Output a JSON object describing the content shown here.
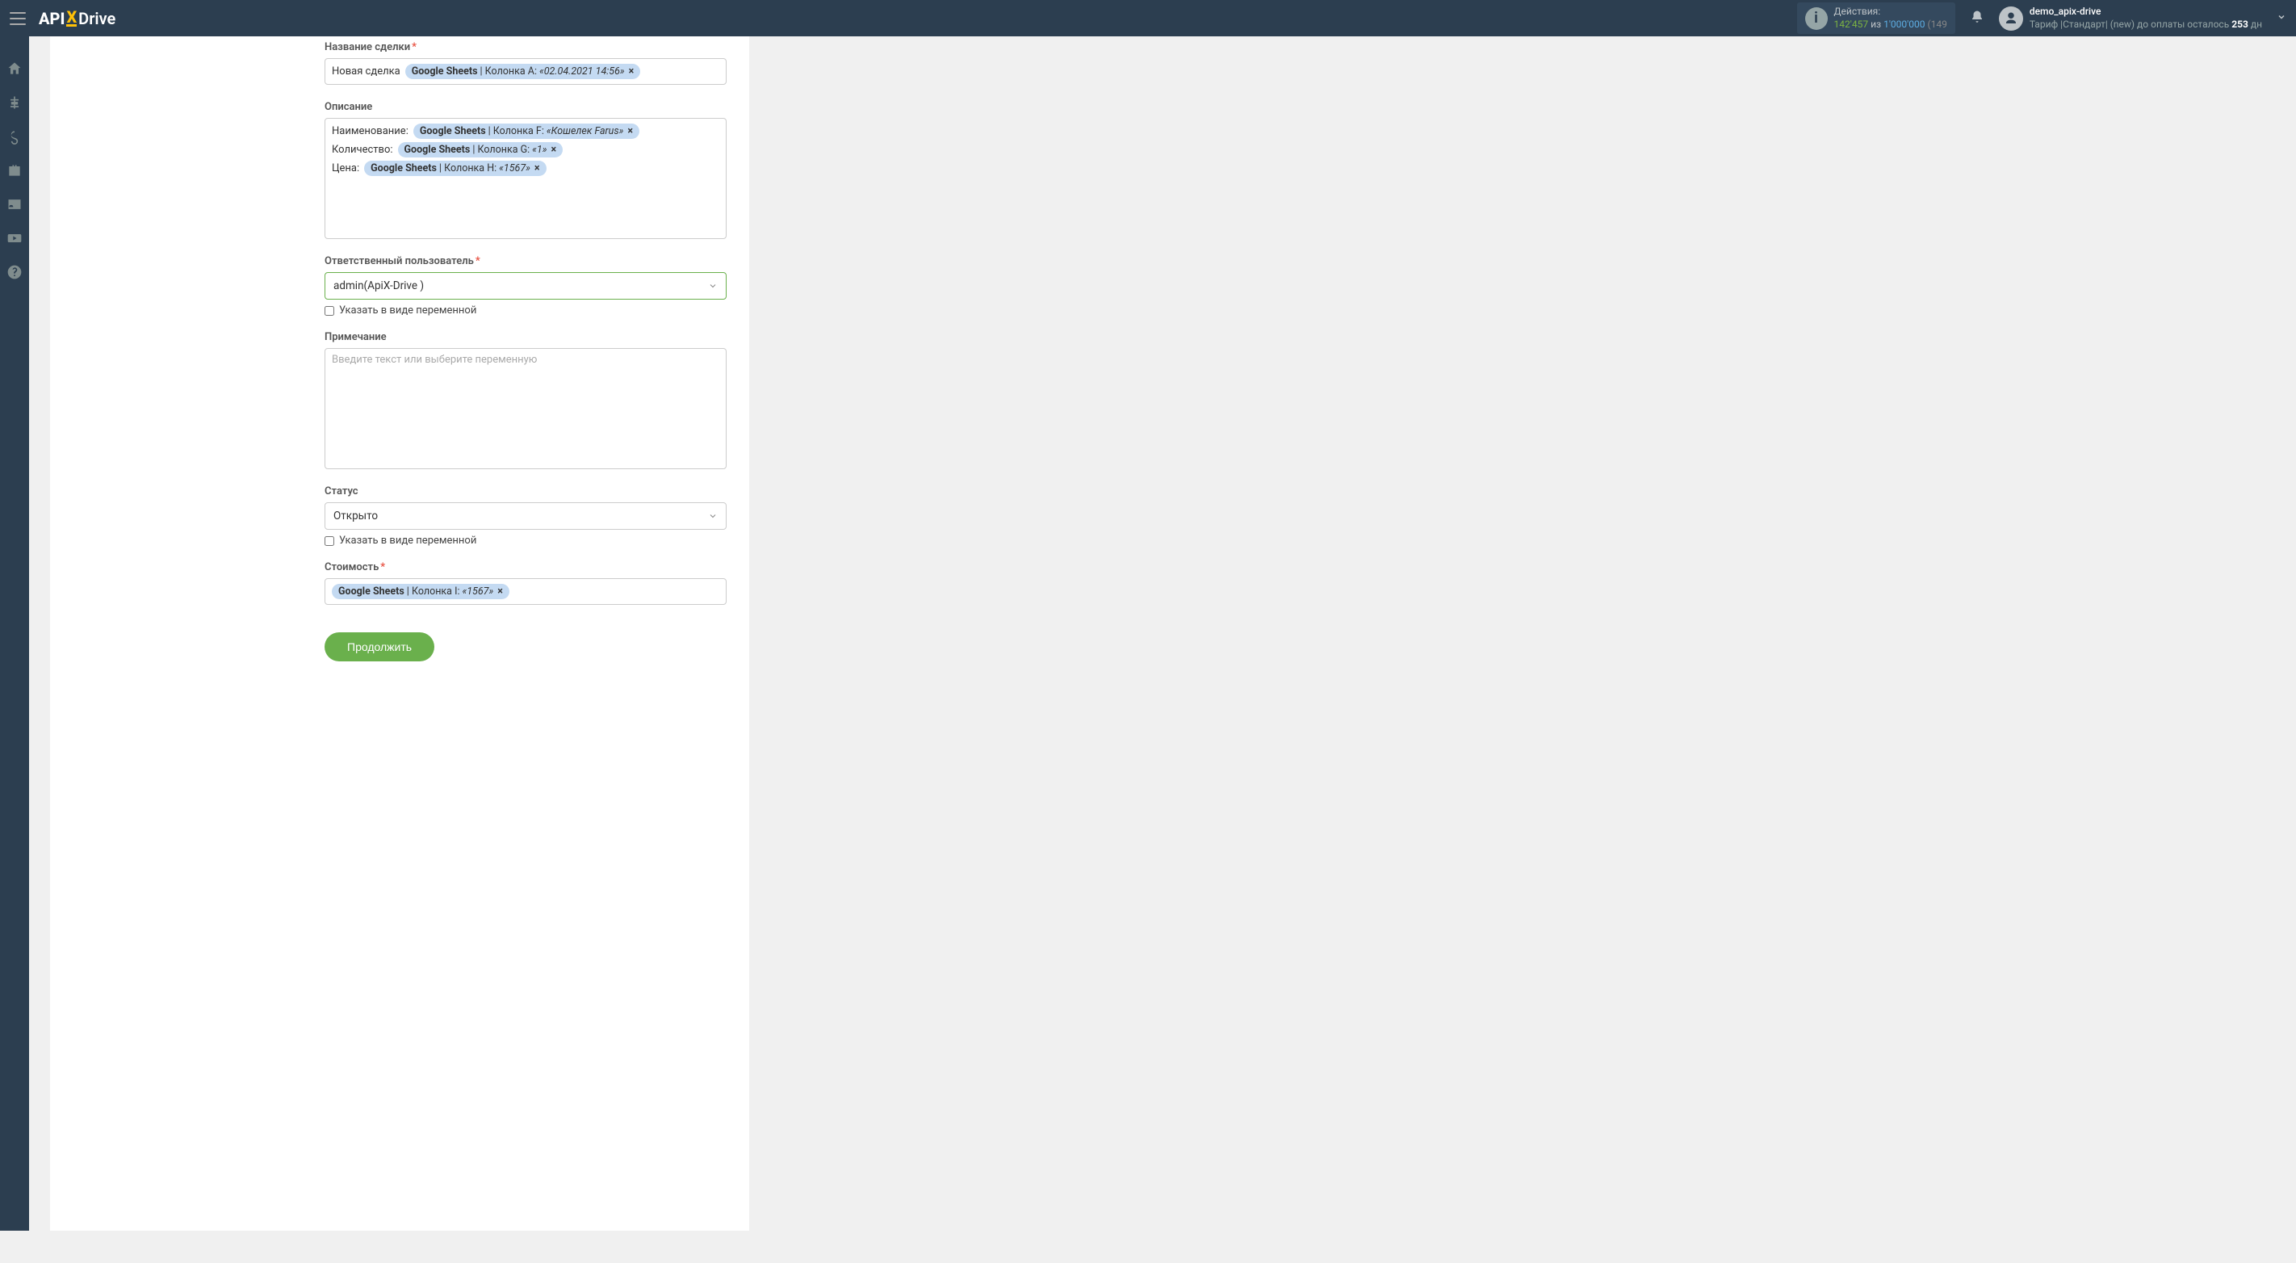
{
  "header": {
    "actions_label": "Действия:",
    "actions_used": "142'457",
    "actions_of": "из",
    "actions_total": "1'000'000",
    "actions_paren": "(149",
    "username": "demo_apix-drive",
    "tariff_prefix": "Тариф |Стандарт| (new) до оплаты осталось ",
    "tariff_days": "253",
    "tariff_suffix": " дн"
  },
  "fields": {
    "deal_name": {
      "label": "Название сделки",
      "plain": "Новая сделка",
      "pill_source": "Google Sheets",
      "pill_col": " | Колонка A: ",
      "pill_val": "«02.04.2021 14:56»"
    },
    "description": {
      "label": "Описание",
      "row1": {
        "plain": "Наименование:",
        "src": "Google Sheets",
        "col": " | Колонка F: ",
        "val": "«Кошелек Farus»"
      },
      "row2": {
        "plain": "Количество:",
        "src": "Google Sheets",
        "col": " | Колонка G: ",
        "val": "«1»"
      },
      "row3": {
        "plain": "Цена:",
        "src": "Google Sheets",
        "col": " | Колонка H: ",
        "val": "«1567»"
      }
    },
    "responsible": {
      "label": "Ответственный пользователь",
      "value": "admin(ApiX-Drive )",
      "checkbox": "Указать в виде переменной"
    },
    "note": {
      "label": "Примечание",
      "placeholder": "Введите текст или выберите переменную"
    },
    "status": {
      "label": "Статус",
      "value": "Открыто",
      "checkbox": "Указать в виде переменной"
    },
    "cost": {
      "label": "Стоимость",
      "pill_src": "Google Sheets",
      "pill_col": " | Колонка I: ",
      "pill_val": "«1567»"
    }
  },
  "button_continue": "Продолжить"
}
